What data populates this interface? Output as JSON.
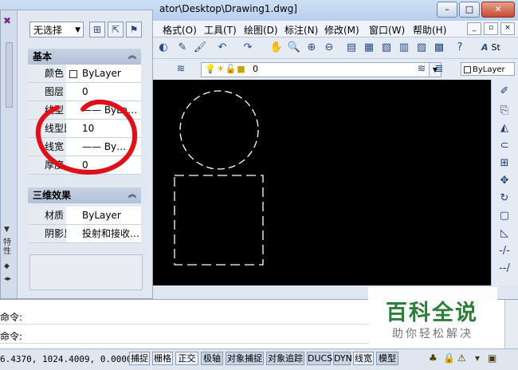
{
  "window": {
    "title": "ator\\Desktop\\Drawing1.dwg]",
    "controls": {
      "minimize": "–",
      "maximize": "□",
      "close": "✕"
    }
  },
  "menubar": {
    "items": [
      "格式(O)",
      "工具(T)",
      "绘图(D)",
      "标注(N)",
      "修改(M)",
      "窗口(W)",
      "帮助(H)"
    ],
    "mdi": {
      "minimize": "_",
      "restore": "▫",
      "close": "×"
    }
  },
  "toolbar1": {
    "style_label": "St"
  },
  "toolbar2": {
    "layer_value": "0",
    "color_value": "ByLayer"
  },
  "palette": {
    "selection": "无选择",
    "side_label": "特性",
    "sections": [
      {
        "header": "基本",
        "rows": [
          {
            "key": "颜色",
            "value": "ByLayer"
          },
          {
            "key": "图层",
            "value": "0"
          },
          {
            "key": "线型",
            "value": "—— ByLa…"
          },
          {
            "key": "线型比…",
            "value": "10"
          },
          {
            "key": "线宽",
            "value": "—— By…"
          },
          {
            "key": "厚度",
            "value": "0"
          }
        ]
      },
      {
        "header": "三维效果",
        "rows": [
          {
            "key": "材质",
            "value": "ByLayer"
          },
          {
            "key": "阴影显…",
            "value": "投射和接收…"
          }
        ]
      }
    ]
  },
  "command": {
    "lines": [
      "命令:",
      "命令:"
    ]
  },
  "status": {
    "coordinates": "6.4370,  1024.4009, 0.0000",
    "toggles": [
      "捕捉",
      "栅格",
      "正交",
      "极轴",
      "对象捕捉",
      "对象追踪",
      "DUCS",
      "DYN",
      "线宽",
      "模型"
    ]
  },
  "watermark": {
    "title": "百科全说",
    "subtitle": "助你轻松解决"
  },
  "colors": {
    "annotation": "#e0101a",
    "canvas": "#000000",
    "dash": "#ffffff",
    "watermark_green": "#2f7d3a"
  }
}
